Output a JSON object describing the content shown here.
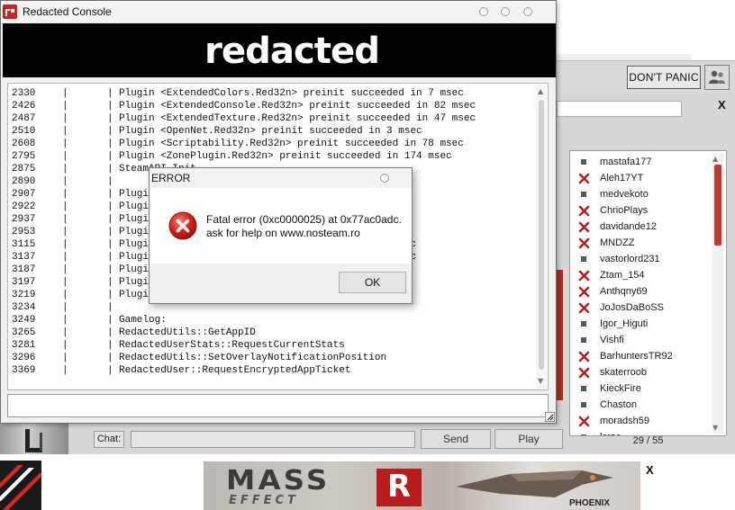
{
  "console": {
    "title": "Redacted Console",
    "logo_text": "redacted",
    "log": [
      {
        "num": "2330",
        "text": "Plugin <ExtendedColors.Red32n> preinit succeeded in 7 msec"
      },
      {
        "num": "2426",
        "text": "Plugin <ExtendedConsole.Red32n> preinit succeeded in 82 msec"
      },
      {
        "num": "2487",
        "text": "Plugin <ExtendedTexture.Red32n> preinit succeeded in 47 msec"
      },
      {
        "num": "2510",
        "text": "Plugin <OpenNet.Red32n> preinit succeeded in 3 msec"
      },
      {
        "num": "2608",
        "text": "Plugin <Scriptability.Red32n> preinit succeeded in 78 msec"
      },
      {
        "num": "2795",
        "text": "Plugin <ZonePlugin.Red32n> preinit succeeded in 174 msec"
      },
      {
        "num": "2875",
        "text": "SteamAPI_Init"
      },
      {
        "num": "2890",
        "text": ""
      },
      {
        "num": "2907",
        "text": "Plugin"
      },
      {
        "num": "2922",
        "text": "Plugin                                  in 0 msec"
      },
      {
        "num": "2937",
        "text": "Plugin                                  in 0 msec"
      },
      {
        "num": "2953",
        "text": "Plugin                                  in 0 msec"
      },
      {
        "num": "3115",
        "text": "Plugin                                ed in 0 msec"
      },
      {
        "num": "3137",
        "text": "Plugin                                ed in 0 msec"
      },
      {
        "num": "3187",
        "text": "Plugin                                 msec"
      },
      {
        "num": "3197",
        "text": "Plugin                                  in 0 msec"
      },
      {
        "num": "3219",
        "text": "Plugin                                 n 0 msec"
      },
      {
        "num": "3234",
        "text": ""
      },
      {
        "num": "3249",
        "text": "Gamelog:"
      },
      {
        "num": "3265",
        "text": "RedactedUtils::GetAppID"
      },
      {
        "num": "3281",
        "text": "RedactedUserStats::RequestCurrentStats"
      },
      {
        "num": "3296",
        "text": "RedactedUtils::SetOverlayNotificationPosition"
      },
      {
        "num": "3369",
        "text": "RedactedUser::RequestEncryptedAppTicket"
      }
    ],
    "input_value": ""
  },
  "error_dialog": {
    "title": "ERROR",
    "line1": "Fatal error (0xc0000025) at 0x77ac0adc.",
    "line2": "ask for help on www.nosteam.ro",
    "ok_label": "OK",
    "icon": "error-icon"
  },
  "launcher": {
    "dont_panic_label": "DON'T PANIC",
    "close_label": "X",
    "players": [
      {
        "name": "mastafa177",
        "icon": "dot"
      },
      {
        "name": "Aleh17YT",
        "icon": "cross"
      },
      {
        "name": "medvekoto",
        "icon": "dot"
      },
      {
        "name": "ChrioPlays",
        "icon": "cross"
      },
      {
        "name": "davidande12",
        "icon": "cross"
      },
      {
        "name": "MNDZZ",
        "icon": "cross"
      },
      {
        "name": "vastorlord231",
        "icon": "dot"
      },
      {
        "name": "Ztam_154",
        "icon": "cross"
      },
      {
        "name": "Anthqny69",
        "icon": "cross"
      },
      {
        "name": "JoJosDaBoSS",
        "icon": "cross"
      },
      {
        "name": "Igor_Higuti",
        "icon": "dot"
      },
      {
        "name": "Vishfi",
        "icon": "dot"
      },
      {
        "name": "BarhuntersTR92",
        "icon": "cross"
      },
      {
        "name": "skaterroob",
        "icon": "cross"
      },
      {
        "name": "KieckFire",
        "icon": "dot"
      },
      {
        "name": "Chaston",
        "icon": "dot"
      },
      {
        "name": "moradsh59",
        "icon": "cross"
      },
      {
        "name": "lcrac",
        "icon": "dot"
      }
    ],
    "player_count": "29 / 55",
    "chat_label": "Chat:",
    "chat_value": "",
    "send_label": "Send",
    "play_label": "Play"
  },
  "ad": {
    "title": "MASS",
    "subtitle": "EFFECT",
    "badge": "R",
    "brand": "PHOENIX",
    "close_label": "X"
  },
  "colors": {
    "accent_red": "#c8231e",
    "banner_black": "#000000"
  }
}
